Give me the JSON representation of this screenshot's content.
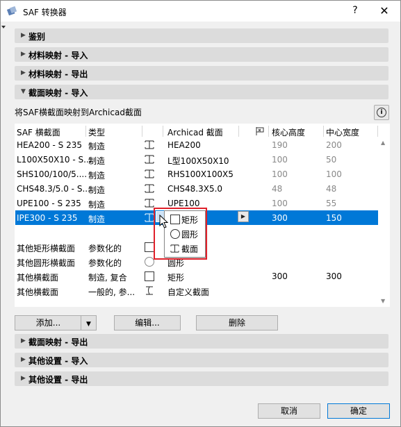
{
  "window": {
    "title": "SAF 转换器",
    "help_glyph": "?",
    "close_glyph": "✕",
    "icon": "app-icon"
  },
  "sections_top": [
    {
      "label": "鉴别",
      "expanded": false
    },
    {
      "label": "材料映射 - 导入",
      "expanded": false
    },
    {
      "label": "材料映射 - 导出",
      "expanded": false
    },
    {
      "label": "截面映射 - 导入",
      "expanded": true
    }
  ],
  "description": "将SAF横截面映射到Archicad截面",
  "info_glyph": "i",
  "table": {
    "headers": [
      "SAF 横截面",
      "类型",
      "Archicad 截面",
      "核心高度",
      "中心宽度"
    ],
    "rows": [
      {
        "saf": "HEA200 - S 235",
        "type": "制造",
        "archicad": "HEA200",
        "core": "190",
        "center": "200",
        "selected": false
      },
      {
        "saf": "L100X50X10 - S...",
        "type": "制造",
        "archicad": "L型100X50X10",
        "core": "100",
        "center": "50",
        "selected": false
      },
      {
        "saf": "SHS100/100/5....",
        "type": "制造",
        "archicad": "RHS100X100X5",
        "core": "100",
        "center": "100",
        "selected": false
      },
      {
        "saf": "CHS48.3/5.0 - S...",
        "type": "制造",
        "archicad": "CHS48.3X5.0",
        "core": "48",
        "center": "48",
        "selected": false
      },
      {
        "saf": "UPE100 - S 235",
        "type": "制造",
        "archicad": "UPE100",
        "core": "100",
        "center": "55",
        "selected": false
      },
      {
        "saf": "IPE300 - S 235",
        "type": "制造",
        "archicad": "",
        "core": "300",
        "center": "150",
        "selected": true
      }
    ],
    "other_rows": [
      {
        "saf": "其他矩形横截面",
        "type": "参数化的",
        "archicad": "",
        "core": "",
        "center": ""
      },
      {
        "saf": "其他圆形横截面",
        "type": "参数化的",
        "archicad": "圆形",
        "core": "",
        "center": ""
      },
      {
        "saf": "其他横截面",
        "type": "制造, 复合",
        "archicad": "矩形",
        "core": "300",
        "center": "300"
      },
      {
        "saf": "其他横截面",
        "type": "一般的, 参...",
        "archicad": "自定义截面",
        "core": "",
        "center": ""
      }
    ]
  },
  "popup_menu": {
    "items": [
      "矩形",
      "圆形",
      "截面"
    ]
  },
  "buttons": {
    "add": "添加...",
    "edit": "编辑...",
    "delete": "删除",
    "cancel": "取消",
    "ok": "确定"
  },
  "sections_bottom": [
    {
      "label": "截面映射 - 导出",
      "expanded": false
    },
    {
      "label": "其他设置 - 导入",
      "expanded": false
    },
    {
      "label": "其他设置 - 导出",
      "expanded": false
    }
  ],
  "colors": {
    "selection": "#0078d7",
    "highlight_box": "#e0202a",
    "section_bar": "#dcdcdc"
  }
}
